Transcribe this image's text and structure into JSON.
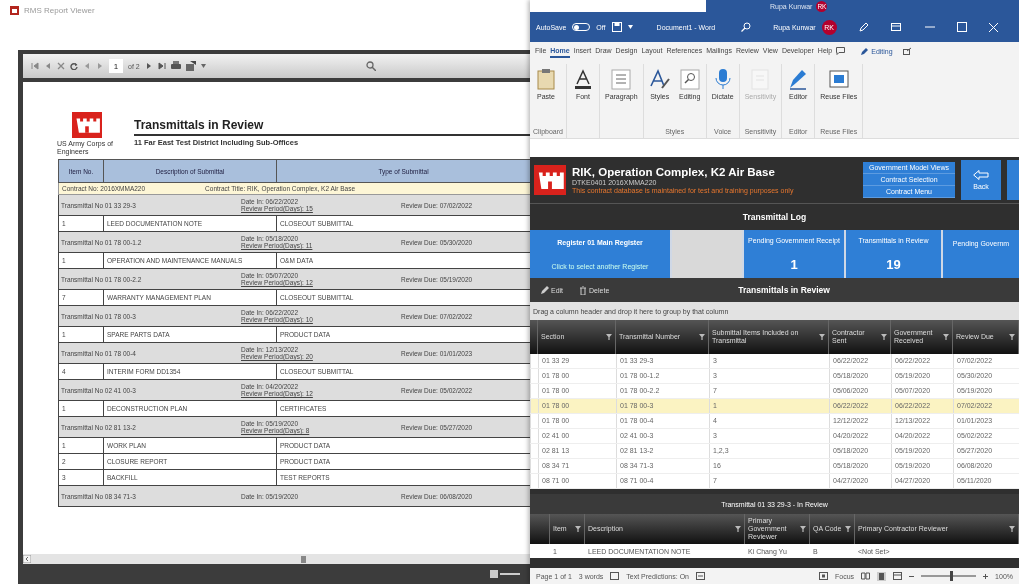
{
  "report_viewer": {
    "title": "RMS Report Viewer",
    "toolbar": {
      "page": "1",
      "page_count": "of 2"
    },
    "report": {
      "title": "Transmittals in Review",
      "subtitle": "11 Far East Test District Including Sub-Offices",
      "logo_caption": "US Army Corps of Engineers",
      "columns": [
        "Item No.",
        "Description of Submittal",
        "Type of Submittal"
      ],
      "contract_no": "Contract No: 2016XMMA220",
      "contract_title": "Contract Title: RIK, Operation Complex, K2 Air Base",
      "groups": [
        {
          "transmittal": "Transmittal No 01 33 29-3",
          "date_in": "Date In: 06/22/2022",
          "review_period": "Review Period(Days): 15",
          "review_due": "Review Due: 07/02/2022",
          "items": [
            {
              "item_no": "1",
              "description": "LEED DOCUMENTATION NOTE",
              "type": "CLOSEOUT SUBMITTAL"
            }
          ]
        },
        {
          "transmittal": "Transmittal No 01 78 00-1.2",
          "date_in": "Date In: 05/18/2020",
          "review_period": "Review Period(Days): 11",
          "review_due": "Review Due: 05/30/2020",
          "items": [
            {
              "item_no": "1",
              "description": "OPERATION AND MAINTENANCE MANUALS",
              "type": "O&M DATA"
            }
          ]
        },
        {
          "transmittal": "Transmittal No 01 78 00-2.2",
          "date_in": "Date In: 05/07/2020",
          "review_period": "Review Period(Days): 12",
          "review_due": "Review Due: 05/19/2020",
          "items": [
            {
              "item_no": "7",
              "description": "WARRANTY MANAGEMENT PLAN",
              "type": "CLOSEOUT SUBMITTAL"
            }
          ]
        },
        {
          "transmittal": "Transmittal No 01 78 00-3",
          "date_in": "Date In: 06/22/2022",
          "review_period": "Review Period(Days): 10",
          "review_due": "Review Due: 07/02/2022",
          "items": [
            {
              "item_no": "1",
              "description": "SPARE PARTS DATA",
              "type": "PRODUCT DATA"
            }
          ]
        },
        {
          "transmittal": "Transmittal No 01 78 00-4",
          "date_in": "Date In: 12/13/2022",
          "review_period": "Review Period(Days): 20",
          "review_due": "Review Due: 01/01/2023",
          "items": [
            {
              "item_no": "4",
              "description": "INTERIM FORM DD1354",
              "type": "CLOSEOUT SUBMITTAL"
            }
          ]
        },
        {
          "transmittal": "Transmittal No 02 41 00-3",
          "date_in": "Date In: 04/20/2022",
          "review_period": "Review Period(Days): 12",
          "review_due": "Review Due: 05/02/2022",
          "items": [
            {
              "item_no": "1",
              "description": "DECONSTRUCTION PLAN",
              "type": "CERTIFICATES"
            }
          ]
        },
        {
          "transmittal": "Transmittal No 02 81 13-2",
          "date_in": "Date In: 05/19/2020",
          "review_period": "Review Period(Days): 8",
          "review_due": "Review Due: 05/27/2020",
          "items": [
            {
              "item_no": "1",
              "description": "WORK PLAN",
              "type": "PRODUCT DATA"
            },
            {
              "item_no": "2",
              "description": "CLOSURE REPORT",
              "type": "PRODUCT DATA"
            },
            {
              "item_no": "3",
              "description": "BACKFILL",
              "type": "TEST REPORTS"
            }
          ]
        },
        {
          "transmittal": "Transmittal No 08 34 71-3",
          "date_in": "Date In: 05/19/2020",
          "review_due": "Review Due: 06/08/2020"
        }
      ]
    }
  },
  "word": {
    "top_strip": {
      "user": "Rupa Kunwar",
      "initials": "RK"
    },
    "title_bar": {
      "autosave": "AutoSave",
      "autosave_on": false,
      "toggle_label": "Off",
      "document": "Document1 - Word",
      "user": "Rupa Kunwar",
      "initials": "RK"
    },
    "menu_tabs": [
      {
        "label": "File",
        "selected": false
      },
      {
        "label": "Home",
        "selected": true
      },
      {
        "label": "Insert",
        "selected": false
      },
      {
        "label": "Draw",
        "selected": false
      },
      {
        "label": "Design",
        "selected": false
      },
      {
        "label": "Layout",
        "selected": false
      },
      {
        "label": "References",
        "selected": false
      },
      {
        "label": "Mailings",
        "selected": false
      },
      {
        "label": "Review",
        "selected": false
      },
      {
        "label": "View",
        "selected": false
      },
      {
        "label": "Developer",
        "selected": false
      },
      {
        "label": "Help",
        "selected": false
      }
    ],
    "editing": "Editing",
    "ribbon": [
      {
        "label": "Clipboard",
        "buttons": [
          {
            "kind": "clipboard",
            "label": "Paste",
            "disabled": false
          }
        ]
      },
      {
        "buttons": [
          {
            "kind": "font",
            "label": "Font",
            "disabled": false
          }
        ]
      },
      {
        "buttons": [
          {
            "kind": "paragraph",
            "label": "Paragraph",
            "disabled": false
          }
        ]
      },
      {
        "label": "Styles",
        "buttons": [
          {
            "kind": "styles",
            "label": "Styles",
            "disabled": false
          },
          {
            "kind": "find",
            "label": "Editing",
            "disabled": false
          }
        ]
      },
      {
        "label": "Voice",
        "buttons": [
          {
            "kind": "mic",
            "label": "Dictate",
            "disabled": false
          }
        ]
      },
      {
        "label": "Sensitivity",
        "buttons": [
          {
            "kind": "shield",
            "label": "Sensitivity",
            "disabled": true
          }
        ]
      },
      {
        "label": "Editor",
        "buttons": [
          {
            "kind": "pen",
            "label": "Editor",
            "disabled": false
          }
        ]
      },
      {
        "label": "Reuse Files",
        "buttons": [
          {
            "kind": "reuse",
            "label": "Reuse Files",
            "disabled": false
          }
        ]
      }
    ],
    "app": {
      "title": "RIK, Operation Complex, K2 Air Base",
      "code": "DTKE0401 2016XMMA220",
      "notice": "This contract database is maintained for test and training purposes only",
      "nav_buttons": [
        "Government Model Views",
        "Contract Selection",
        "Contract Menu"
      ],
      "back": "Back",
      "section": "Transmittal Log",
      "tiles": [
        {
          "kind": "register",
          "title": "Register 01 Main Register",
          "subtitle": "Click to select another Register"
        },
        {
          "kind": "blank"
        },
        {
          "kind": "count",
          "title": "Pending Government Receipt",
          "value": "1"
        },
        {
          "kind": "count",
          "title": "Transmittals in Review",
          "value": "19"
        },
        {
          "kind": "count",
          "title": "Pending Governm"
        }
      ],
      "grid": {
        "title": "Transmittals in Review",
        "actions": [
          "Edit",
          "Delete"
        ],
        "group_hint": "Drag a column header and drop it here to group by that column",
        "columns": [
          "Section",
          "Transmittal Number",
          "Submittal Items Included on Transmittal",
          "Contractor Sent",
          "Government Received",
          "Review Due"
        ],
        "rows": [
          {
            "cells": [
              "01 33 29",
              "01 33 29-3",
              "3",
              "06/22/2022",
              "06/22/2022",
              "07/02/2022"
            ],
            "selected": false
          },
          {
            "cells": [
              "01 78 00",
              "01 78 00-1.2",
              "3",
              "05/18/2020",
              "05/19/2020",
              "05/30/2020"
            ],
            "selected": false
          },
          {
            "cells": [
              "01 78 00",
              "01 78 00-2.2",
              "7",
              "05/06/2020",
              "05/07/2020",
              "05/19/2020"
            ],
            "selected": false
          },
          {
            "cells": [
              "01 78 00",
              "01 78 00-3",
              "1",
              "06/22/2022",
              "06/22/2022",
              "07/02/2022"
            ],
            "selected": true
          },
          {
            "cells": [
              "01 78 00",
              "01 78 00-4",
              "4",
              "12/12/2022",
              "12/13/2022",
              "01/01/2023"
            ],
            "selected": false
          },
          {
            "cells": [
              "02 41 00",
              "02 41 00-3",
              "3",
              "04/20/2022",
              "04/20/2022",
              "05/02/2022"
            ],
            "selected": false
          },
          {
            "cells": [
              "02 81 13",
              "02 81 13-2",
              "1,2,3",
              "05/18/2020",
              "05/19/2020",
              "05/27/2020"
            ],
            "selected": false
          },
          {
            "cells": [
              "08 34 71",
              "08 34 71-3",
              "16",
              "05/18/2020",
              "05/19/2020",
              "06/08/2020"
            ],
            "selected": false
          },
          {
            "cells": [
              "08 71 00",
              "08 71 00-4",
              "7",
              "04/27/2020",
              "04/27/2020",
              "05/11/2020"
            ],
            "selected": false
          }
        ]
      },
      "detail": {
        "title": "Transmittal 01 33 29-3 - In Review",
        "columns": [
          "Item",
          "Description",
          "Primary Government Reviewer",
          "QA Code",
          "Primary Contractor Reviewer"
        ],
        "rows": [
          {
            "cells": [
              "1",
              "LEED DOCUMENTATION NOTE",
              "Ki Chang Yu",
              "B",
              "<Not Set>"
            ]
          }
        ]
      }
    },
    "status_bar": {
      "page": "Page 1 of 1",
      "words": "3 words",
      "predictions": "Text Predictions: On",
      "focus": "Focus",
      "zoom": {
        "level": 0.55
      },
      "zoom_label": "100%"
    }
  }
}
